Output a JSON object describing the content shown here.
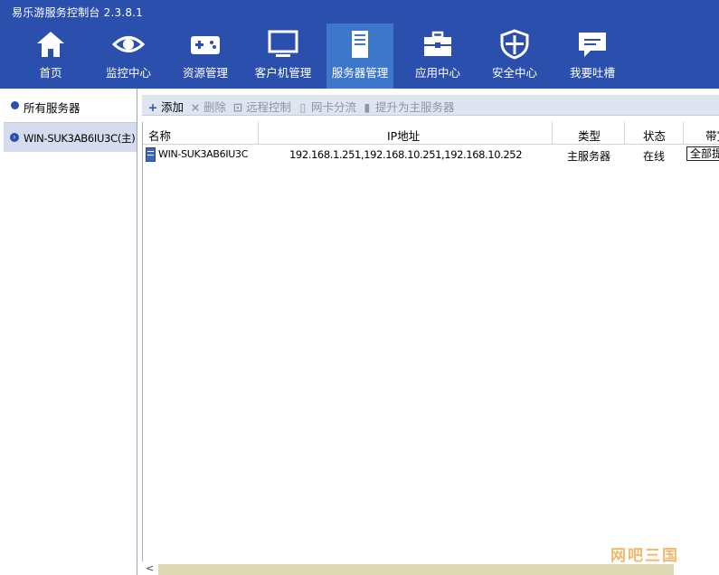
{
  "window": {
    "title": "易乐游服务控制台 2.3.8.1"
  },
  "nav": [
    {
      "label": "首页",
      "icon": "home-icon"
    },
    {
      "label": "监控中心",
      "icon": "eye-icon"
    },
    {
      "label": "资源管理",
      "icon": "gamepad-icon"
    },
    {
      "label": "客户机管理",
      "icon": "monitor-icon"
    },
    {
      "label": "服务器管理",
      "icon": "server-icon",
      "active": true
    },
    {
      "label": "应用中心",
      "icon": "toolbox-icon"
    },
    {
      "label": "安全中心",
      "icon": "shield-icon"
    },
    {
      "label": "我要吐槽",
      "icon": "chat-icon"
    }
  ],
  "sidebar": {
    "header": "所有服务器",
    "server": "WIN-SUK3AB6IU3C(主)"
  },
  "toolbar": {
    "add": "添加",
    "delete": "删除",
    "remote": "远程控制",
    "nic": "网卡分流",
    "promote": "提升为主服务器"
  },
  "table": {
    "columns": [
      "名称",
      "IP地址",
      "类型",
      "状态",
      "带宽"
    ],
    "rows": [
      {
        "name": "WIN-SUK3AB6IU3C",
        "ip": "192.168.1.251,192.168.10.251,192.168.10.252",
        "type": "主服务器",
        "status": "在线",
        "bandwidth": "全部提"
      }
    ]
  },
  "watermark": "网吧三国",
  "colors": {
    "accent": "#2a4fad",
    "active_tab": "#3d77c9"
  }
}
